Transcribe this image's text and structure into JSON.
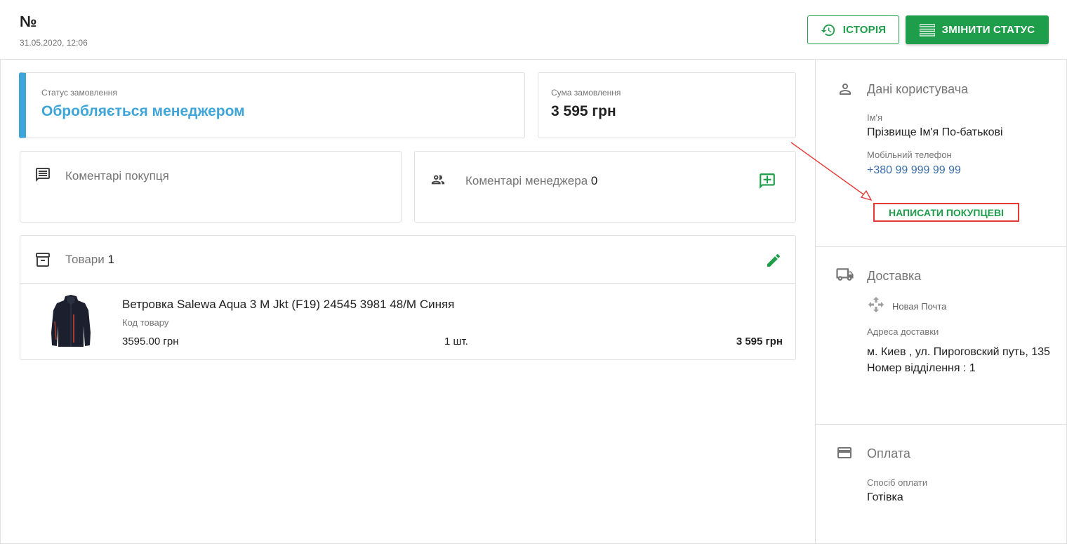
{
  "header": {
    "order_no": "№",
    "order_date": "31.05.2020, 12:06",
    "history_label": "ІСТОРІЯ",
    "change_status_label": "ЗМІНИТИ СТАТУС"
  },
  "status_card": {
    "label": "Статус замовлення",
    "value": "Обробляється менеджером"
  },
  "sum_card": {
    "label": "Сума замовлення",
    "value": "3 595 грн"
  },
  "buyer_comments": {
    "title": "Коментарі покупця"
  },
  "manager_comments": {
    "title": "Коментарі менеджера",
    "count": "0"
  },
  "goods": {
    "title": "Товари",
    "count": "1",
    "items": [
      {
        "name": "Ветровка Salewa Aqua 3 M Jkt (F19) 24545 3981 48/M Синяя",
        "code_label": "Код товару",
        "price": "3595.00 грн",
        "qty": "1 шт.",
        "total": "3 595 грн"
      }
    ]
  },
  "user": {
    "title": "Дані користувача",
    "name_label": "Ім'я",
    "name_value": "Прізвище Ім'я По-батькові",
    "phone_label": "Мобільний телефон",
    "phone_value": "+380 99 999 99 99",
    "write_label": "НАПИСАТИ ПОКУПЦЕВІ"
  },
  "delivery": {
    "title": "Доставка",
    "carrier": "Новая Почта",
    "address_label": "Адреса доставки",
    "address_line1": "м. Киев , ул. Пироговский путь, 135",
    "address_line2": "Номер відділення : 1"
  },
  "payment": {
    "title": "Оплата",
    "method_label": "Спосіб оплати",
    "method_value": "Готівка"
  },
  "colors": {
    "accent_green": "#1e9e4a",
    "status_blue": "#3ea5d8",
    "annotation_red": "#e53935"
  },
  "icons": [
    "history-icon",
    "list-icon",
    "comment-icon",
    "people-icon",
    "add-comment-icon",
    "archive-icon",
    "edit-icon",
    "person-icon",
    "truck-icon",
    "nova-poshta-icon",
    "card-icon"
  ]
}
